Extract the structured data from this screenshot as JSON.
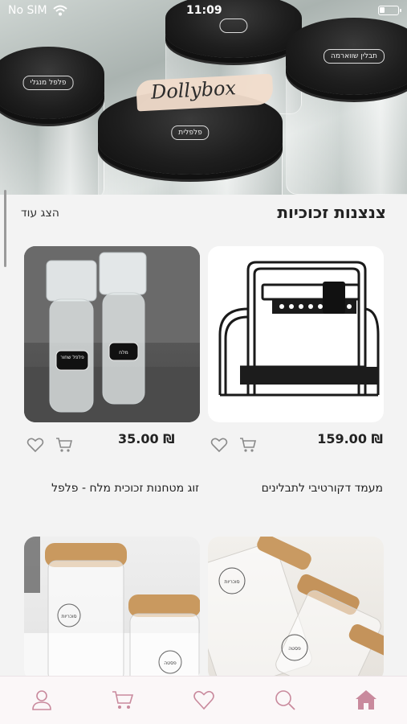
{
  "status_bar": {
    "carrier": "No SIM",
    "time": "11:09"
  },
  "hero": {
    "brand": "Dollybox",
    "jar_tags": [
      "פלפל מנגלי",
      "פלפלית",
      "תבלין שווארמה",
      "קימ"
    ]
  },
  "section": {
    "title": "צנצנות זכוכיות",
    "show_more": "הצג עוד"
  },
  "products": [
    {
      "name": "מעמד דקורטיבי לתבלינים",
      "price": "₪ 159.00"
    },
    {
      "name": "זוג מטחנות זכוכית מלח - פלפל",
      "price": "₪ 35.00"
    }
  ],
  "product_tags": [
    "מלח",
    "פלפל שחור"
  ],
  "jar_labels": [
    "סוכריות",
    "פסטה"
  ],
  "colors": {
    "accent": "#c98a9d",
    "icon_gray": "#8a8a8a"
  },
  "icons": {
    "product_actions": [
      "heart-icon",
      "cart-icon"
    ],
    "bottom_nav": [
      "user-icon",
      "cart-icon",
      "heart-icon",
      "search-icon",
      "home-icon"
    ]
  }
}
